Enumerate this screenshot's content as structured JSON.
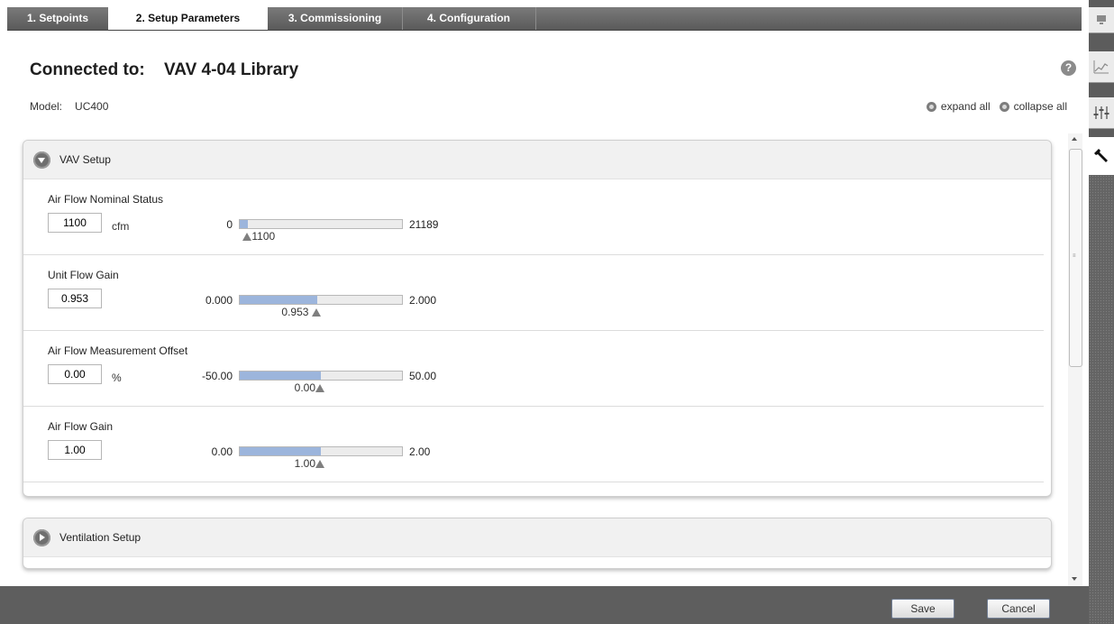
{
  "tabs": [
    {
      "label": "1. Setpoints",
      "active": false
    },
    {
      "label": "2. Setup Parameters",
      "active": true
    },
    {
      "label": "3. Commissioning",
      "active": false
    },
    {
      "label": "4. Configuration",
      "active": false
    }
  ],
  "header": {
    "connected_label": "Connected to:",
    "device_name": "VAV 4-04 Library",
    "model_label": "Model:",
    "model_value": "UC400",
    "help_glyph": "?",
    "expand_all": "expand all",
    "collapse_all": "collapse all"
  },
  "sections": [
    {
      "title": "VAV Setup",
      "expanded": true,
      "params": [
        {
          "label": "Air Flow Nominal Status",
          "value": "1100",
          "unit": "cfm",
          "min": "0",
          "max": "21189",
          "marker": "1100",
          "fraction": 0.052
        },
        {
          "label": "Unit Flow Gain",
          "value": "0.953",
          "unit": "",
          "min": "0.000",
          "max": "2.000",
          "marker": "0.953",
          "fraction": 0.4765
        },
        {
          "label": "Air Flow Measurement Offset",
          "value": "0.00",
          "unit": "%",
          "min": "-50.00",
          "max": "50.00",
          "marker": "0.00",
          "fraction": 0.5
        },
        {
          "label": "Air Flow Gain",
          "value": "1.00",
          "unit": "",
          "min": "0.00",
          "max": "2.00",
          "marker": "1.00",
          "fraction": 0.5
        }
      ]
    },
    {
      "title": "Ventilation Setup",
      "expanded": false
    }
  ],
  "footer": {
    "save_label": "Save",
    "cancel_label": "Cancel"
  },
  "rail_icons": [
    "monitor-icon",
    "trend-chart-icon",
    "sliders-icon",
    "wrench-icon"
  ],
  "colors": {
    "slider_fill": "#9cb5dc",
    "tab_bar": "#5a5a5a",
    "footer": "#5e5e5e"
  }
}
